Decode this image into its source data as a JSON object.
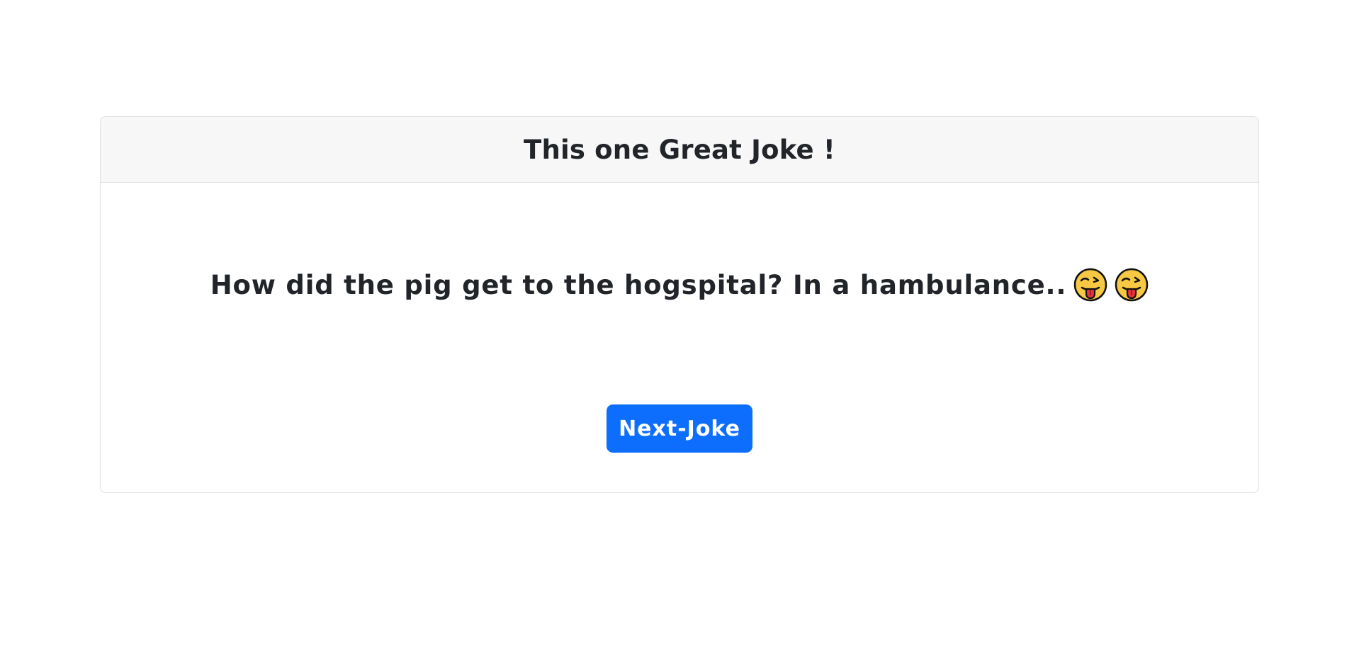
{
  "card": {
    "title": "This one Great Joke !",
    "joke_text": "How did the pig get to the hogspital? In a hambulance..",
    "emojis": [
      "winking-face-with-tongue-icon",
      "winking-face-with-tongue-icon"
    ],
    "next_button_label": "Next-Joke"
  },
  "colors": {
    "accent": "#0d6efd",
    "header_background": "#f7f7f7",
    "text": "#212529"
  }
}
